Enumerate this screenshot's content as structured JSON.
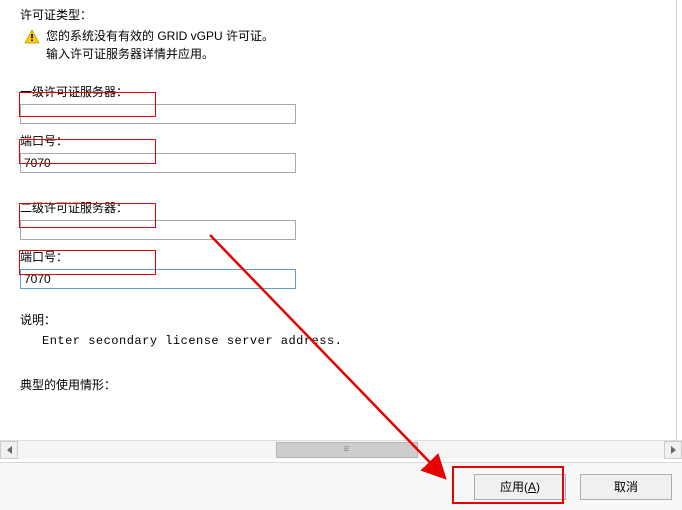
{
  "header": {
    "type_label": "许可证类型：",
    "warn_line1": "您的系统没有有效的 GRID vGPU 许可证。",
    "warn_line2": "输入许可证服务器详情并应用。"
  },
  "primary": {
    "server_label": "一级许可证服务器：",
    "server_value": "",
    "port_label": "端口号：",
    "port_value": "7070"
  },
  "secondary": {
    "server_label": "二级许可证服务器：",
    "server_value": "",
    "port_label": "端口号：",
    "port_value": "7070"
  },
  "description": {
    "label": "说明：",
    "text": "Enter secondary license server address."
  },
  "usage": {
    "label": "典型的使用情形："
  },
  "buttons": {
    "apply": "应用(A)",
    "apply_underline_char": "A",
    "cancel": "取消"
  },
  "colors": {
    "annotation_red": "#e60000"
  }
}
